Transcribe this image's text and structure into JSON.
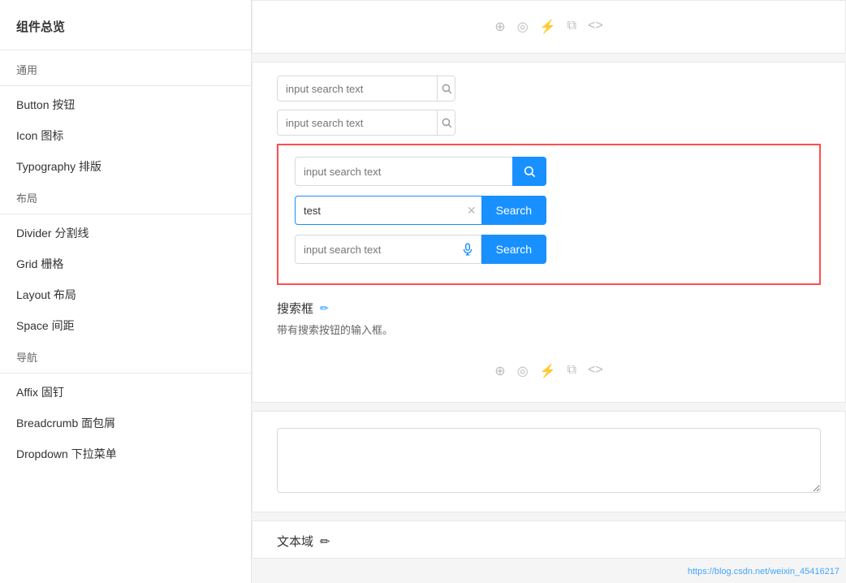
{
  "sidebar": {
    "title": "组件总览",
    "sections": [
      {
        "type": "label",
        "text": "通用"
      },
      {
        "type": "divider"
      },
      {
        "type": "item",
        "text": "Button 按钮"
      },
      {
        "type": "item",
        "text": "Icon 图标"
      },
      {
        "type": "item",
        "text": "Typography 排版"
      },
      {
        "type": "label",
        "text": "布局"
      },
      {
        "type": "divider"
      },
      {
        "type": "item",
        "text": "Divider 分割线"
      },
      {
        "type": "item",
        "text": "Grid 栅格"
      },
      {
        "type": "item",
        "text": "Layout 布局"
      },
      {
        "type": "item",
        "text": "Space 间距"
      },
      {
        "type": "label",
        "text": "导航"
      },
      {
        "type": "divider"
      },
      {
        "type": "item",
        "text": "Affix 固钉"
      },
      {
        "type": "item",
        "text": "Breadcrumb 面包屑"
      },
      {
        "type": "item",
        "text": "Dropdown 下拉菜单"
      }
    ]
  },
  "search_section": {
    "input1_placeholder": "input search text",
    "input2_placeholder": "input search text",
    "input3_placeholder": "input search text",
    "input4_value": "test",
    "input4_search_label": "Search",
    "input5_placeholder": "input search text",
    "input5_search_label": "Search"
  },
  "section_label": {
    "title": "搜索框",
    "edit_icon": "✏",
    "description": "带有搜索按钮的输入框。"
  },
  "textarea_section": {
    "title": "文本域",
    "edit_icon": "✏"
  },
  "icon_bar": {
    "icons": [
      "⊕",
      "◎",
      "⚡",
      "⧉",
      "<>"
    ]
  },
  "watermark": "https://blog.csdn.net/weixin_45416217"
}
